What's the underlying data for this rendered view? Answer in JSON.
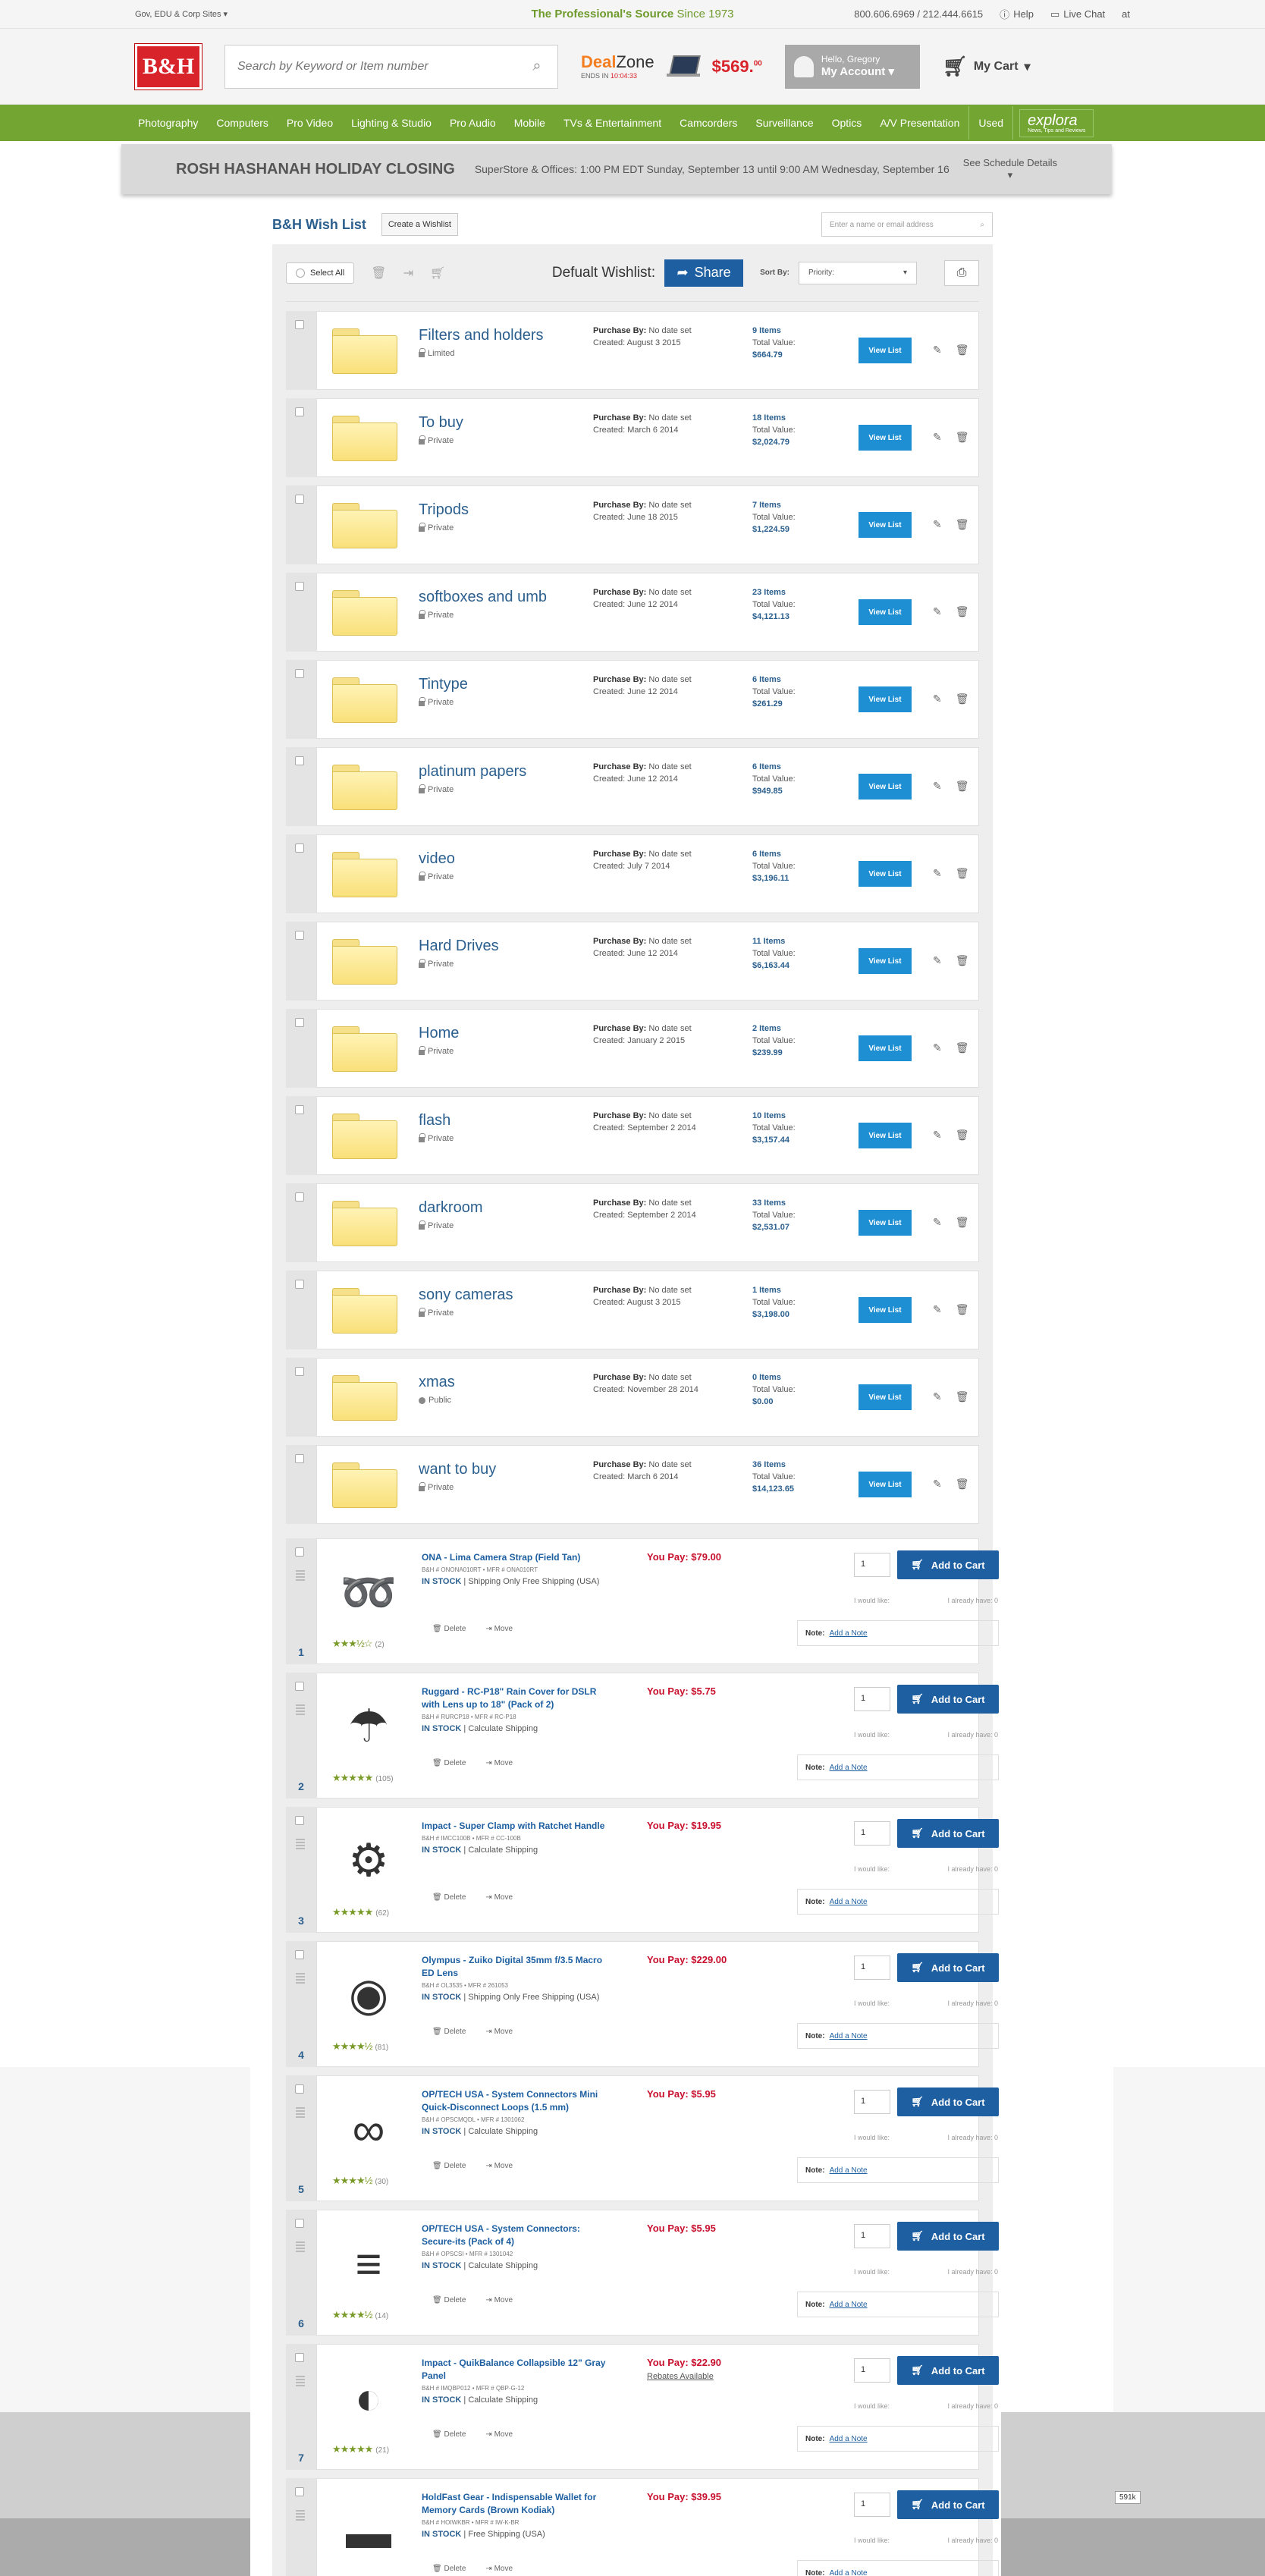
{
  "utility": {
    "gov_link": "Gov, EDU & Corp Sites",
    "tagline_bold": "The Professional's Source",
    "tagline_since": "Since 1973",
    "phones": "800.606.6969 / 212.444.6615",
    "help": "Help",
    "live_chat": "Live Chat",
    "at": "at"
  },
  "header": {
    "logo": "B&H",
    "search_placeholder": "Search by Keyword or Item number",
    "deal_zone": "Deal",
    "deal_zone_b": "Zone",
    "deal_ends_label": "ENDS IN",
    "deal_ends_time": "10:04:33",
    "deal_price": "$569.",
    "deal_price_cents": "00",
    "hello": "Hello, Gregory",
    "my_account": "My Account",
    "my_cart": "My Cart"
  },
  "nav": [
    "Photography",
    "Computers",
    "Pro Video",
    "Lighting & Studio",
    "Pro Audio",
    "Mobile",
    "TVs & Entertainment",
    "Camcorders",
    "Surveillance",
    "Optics",
    "A/V Presentation"
  ],
  "nav_used": "Used",
  "nav_explora": "explora",
  "nav_explora_sub": "News, Tips and Reviews",
  "holiday": {
    "title": "ROSH HASHANAH HOLIDAY CLOSING",
    "text": "SuperStore & Offices: 1:00 PM EDT Sunday, September 13 until 9:00 AM Wednesday, September 16",
    "schedule": "See Schedule Details"
  },
  "wishlist": {
    "title": "B&H Wish List",
    "create": "Create a Wishlist",
    "name_search": "Enter a name or email address",
    "select_all": "Select All",
    "default_label": "Defualt Wishlist:",
    "share": "Share",
    "sort_by": "Sort By:",
    "sort_value": "Priority:"
  },
  "list_labels": {
    "purchase_by": "Purchase By:",
    "no_date": "No date set",
    "total_value": "Total Value:",
    "view_list": "View List"
  },
  "lists": [
    {
      "name": "Filters and holders",
      "privacy": "Limited",
      "created": "Created: August 3 2015",
      "items": "9 Items",
      "value": "$664.79",
      "icon": "lock-icon"
    },
    {
      "name": "To buy",
      "privacy": "Private",
      "created": "Created: March 6 2014",
      "items": "18 Items",
      "value": "$2,024.79",
      "icon": "lock-icon"
    },
    {
      "name": "Tripods",
      "privacy": "Private",
      "created": "Created: June 18 2015",
      "items": "7 Items",
      "value": "$1,224.59",
      "icon": "lock-icon"
    },
    {
      "name": "softboxes and umb",
      "privacy": "Private",
      "created": "Created: June 12 2014",
      "items": "23 Items",
      "value": "$4,121.13",
      "icon": "lock-icon"
    },
    {
      "name": "Tintype",
      "privacy": "Private",
      "created": "Created: June 12 2014",
      "items": "6 Items",
      "value": "$261.29",
      "icon": "lock-icon"
    },
    {
      "name": "platinum papers",
      "privacy": "Private",
      "created": "Created: June 12 2014",
      "items": "6 Items",
      "value": "$949.85",
      "icon": "lock-icon"
    },
    {
      "name": "video",
      "privacy": "Private",
      "created": "Created: July 7 2014",
      "items": "6 Items",
      "value": "$3,196.11",
      "icon": "lock-icon"
    },
    {
      "name": "Hard Drives",
      "privacy": "Private",
      "created": "Created: June 12 2014",
      "items": "11 Items",
      "value": "$6,163.44",
      "icon": "lock-icon"
    },
    {
      "name": "Home",
      "privacy": "Private",
      "created": "Created: January 2 2015",
      "items": "2 Items",
      "value": "$239.99",
      "icon": "lock-icon"
    },
    {
      "name": "flash",
      "privacy": "Private",
      "created": "Created: September 2 2014",
      "items": "10 Items",
      "value": "$3,157.44",
      "icon": "lock-icon"
    },
    {
      "name": "darkroom",
      "privacy": "Private",
      "created": "Created: September 2 2014",
      "items": "33 Items",
      "value": "$2,531.07",
      "icon": "lock-icon"
    },
    {
      "name": "sony cameras",
      "privacy": "Private",
      "created": "Created: August 3 2015",
      "items": "1 Items",
      "value": "$3,198.00",
      "icon": "lock-icon"
    },
    {
      "name": "xmas",
      "privacy": "Public",
      "created": "Created: November 28 2014",
      "items": "0 Items",
      "value": "$0.00",
      "icon": "globe-icon"
    },
    {
      "name": "want to buy",
      "privacy": "Private",
      "created": "Created: March 6 2014",
      "items": "36 Items",
      "value": "$14,123.65",
      "icon": "lock-icon"
    }
  ],
  "item_labels": {
    "in_stock": "IN STOCK",
    "delete": "Delete",
    "move": "Move",
    "add_to_cart": "Add to Cart",
    "would_like": "I would like:",
    "already_have": "I already have: 0",
    "note": "Note:",
    "add_note": "Add a Note",
    "qty": "1"
  },
  "items": [
    {
      "idx": "1",
      "title": "ONA - Lima Camera Strap (Field Tan)",
      "sku": "B&H # ONONA010RT • MFR # ONA010RT",
      "shipping": "Shipping Only   Free Shipping (USA)",
      "price": "You Pay: $79.00",
      "rebate": "",
      "reviews": "(2)",
      "stars": "★★★½☆",
      "icon": "strap-icon",
      "glyph": "➿"
    },
    {
      "idx": "2",
      "title": "Ruggard - RC-P18\" Rain Cover for DSLR with Lens up to 18\" (Pack of 2)",
      "sku": "B&H # RURCP18 • MFR # RC-P18",
      "shipping": "Calculate Shipping",
      "price": "You Pay: $5.75",
      "rebate": "",
      "reviews": "(105)",
      "stars": "★★★★★",
      "icon": "rain-cover-icon",
      "glyph": "☂"
    },
    {
      "idx": "3",
      "title": "Impact - Super Clamp with Ratchet Handle",
      "sku": "B&H # IMCC100B • MFR # CC-100B",
      "shipping": "Calculate Shipping",
      "price": "You Pay: $19.95",
      "rebate": "",
      "reviews": "(62)",
      "stars": "★★★★★",
      "icon": "clamp-icon",
      "glyph": "⚙"
    },
    {
      "idx": "4",
      "title": "Olympus - Zuiko Digital 35mm f/3.5 Macro ED Lens",
      "sku": "B&H # OL3535 • MFR # 261053",
      "shipping": "Shipping Only   Free Shipping (USA)",
      "price": "You Pay: $229.00",
      "rebate": "",
      "reviews": "(81)",
      "stars": "★★★★½",
      "icon": "lens-icon",
      "glyph": "◉"
    },
    {
      "idx": "5",
      "title": "OP/TECH USA - System Connectors Mini Quick-Disconnect Loops (1.5 mm)",
      "sku": "B&H # OPSCMQDL • MFR # 1301062",
      "shipping": "Calculate Shipping",
      "price": "You Pay: $5.95",
      "rebate": "",
      "reviews": "(30)",
      "stars": "★★★★½",
      "icon": "loops-icon",
      "glyph": "∞"
    },
    {
      "idx": "6",
      "title": "OP/TECH USA - System Connectors: Secure-its (Pack of 4)",
      "sku": "B&H # OPSCSI • MFR # 1301042",
      "shipping": "Calculate Shipping",
      "price": "You Pay: $5.95",
      "rebate": "",
      "reviews": "(14)",
      "stars": "★★★★½",
      "icon": "connectors-icon",
      "glyph": "≡"
    },
    {
      "idx": "7",
      "title": "Impact - QuikBalance Collapsible 12\" Gray Panel",
      "sku": "B&H # IMQBP012 • MFR # QBP-G-12",
      "shipping": "Calculate Shipping",
      "price": "You Pay: $22.90",
      "rebate": "Rebates Available",
      "reviews": "(21)",
      "stars": "★★★★★",
      "icon": "gray-panel-icon",
      "glyph": "◐"
    },
    {
      "idx": "8",
      "title": "HoldFast Gear - Indispensable Wallet for Memory Cards (Brown Kodiak)",
      "sku": "B&H # HOIWKBR • MFR # IW-K-BR",
      "shipping": "Free Shipping (USA)",
      "price": "You Pay: $39.95",
      "rebate": "",
      "reviews": "",
      "stars": "",
      "icon": "wallet-icon",
      "glyph": "▬"
    }
  ],
  "badge": "591k"
}
